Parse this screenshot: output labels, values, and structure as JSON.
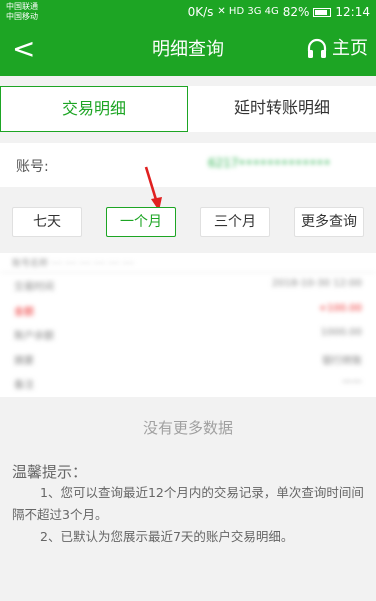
{
  "statusbar": {
    "carrier1": "中国联通",
    "carrier2": "中国移动",
    "network_speed": "0K/s",
    "network_icons": "✕ HD 3G 4G",
    "battery": "82%",
    "battery_level": 0.82,
    "time": "12:14"
  },
  "nav": {
    "back_glyph": "<",
    "title": "明细查询",
    "home_label": "主页"
  },
  "tabs": [
    {
      "label": "交易明细",
      "active": true
    },
    {
      "label": "延时转账明细",
      "active": false
    }
  ],
  "account": {
    "label": "账号:",
    "value": "6217•••••••••••••"
  },
  "filters": [
    {
      "label": "七天",
      "active": false
    },
    {
      "label": "一个月",
      "active": true
    },
    {
      "label": "三个月",
      "active": false
    },
    {
      "label": "更多查询",
      "active": false
    }
  ],
  "records": {
    "header": "账号名称 ···· ···· ···· ···· ···· ····",
    "rows": [
      {
        "label": "交易时间",
        "value": "2018-10-30 12:00",
        "red": false
      },
      {
        "label": "金额",
        "value": "+100.00",
        "red": true
      },
      {
        "label": "账户余额",
        "value": "1000.00",
        "red": false
      },
      {
        "label": "摘要",
        "value": "银行转账",
        "red": false
      },
      {
        "label": "备注",
        "value": "——",
        "red": false
      }
    ]
  },
  "no_more": "没有更多数据",
  "tips": {
    "title": "温馨提示：",
    "items": [
      "1、您可以查询最近12个月内的交易记录，单次查询时间间隔不超过3个月。",
      "2、已默认为您展示最近7天的账户交易明细。"
    ]
  },
  "colors": {
    "brand_green": "#1da524",
    "annotation_arrow": "#e02020"
  }
}
